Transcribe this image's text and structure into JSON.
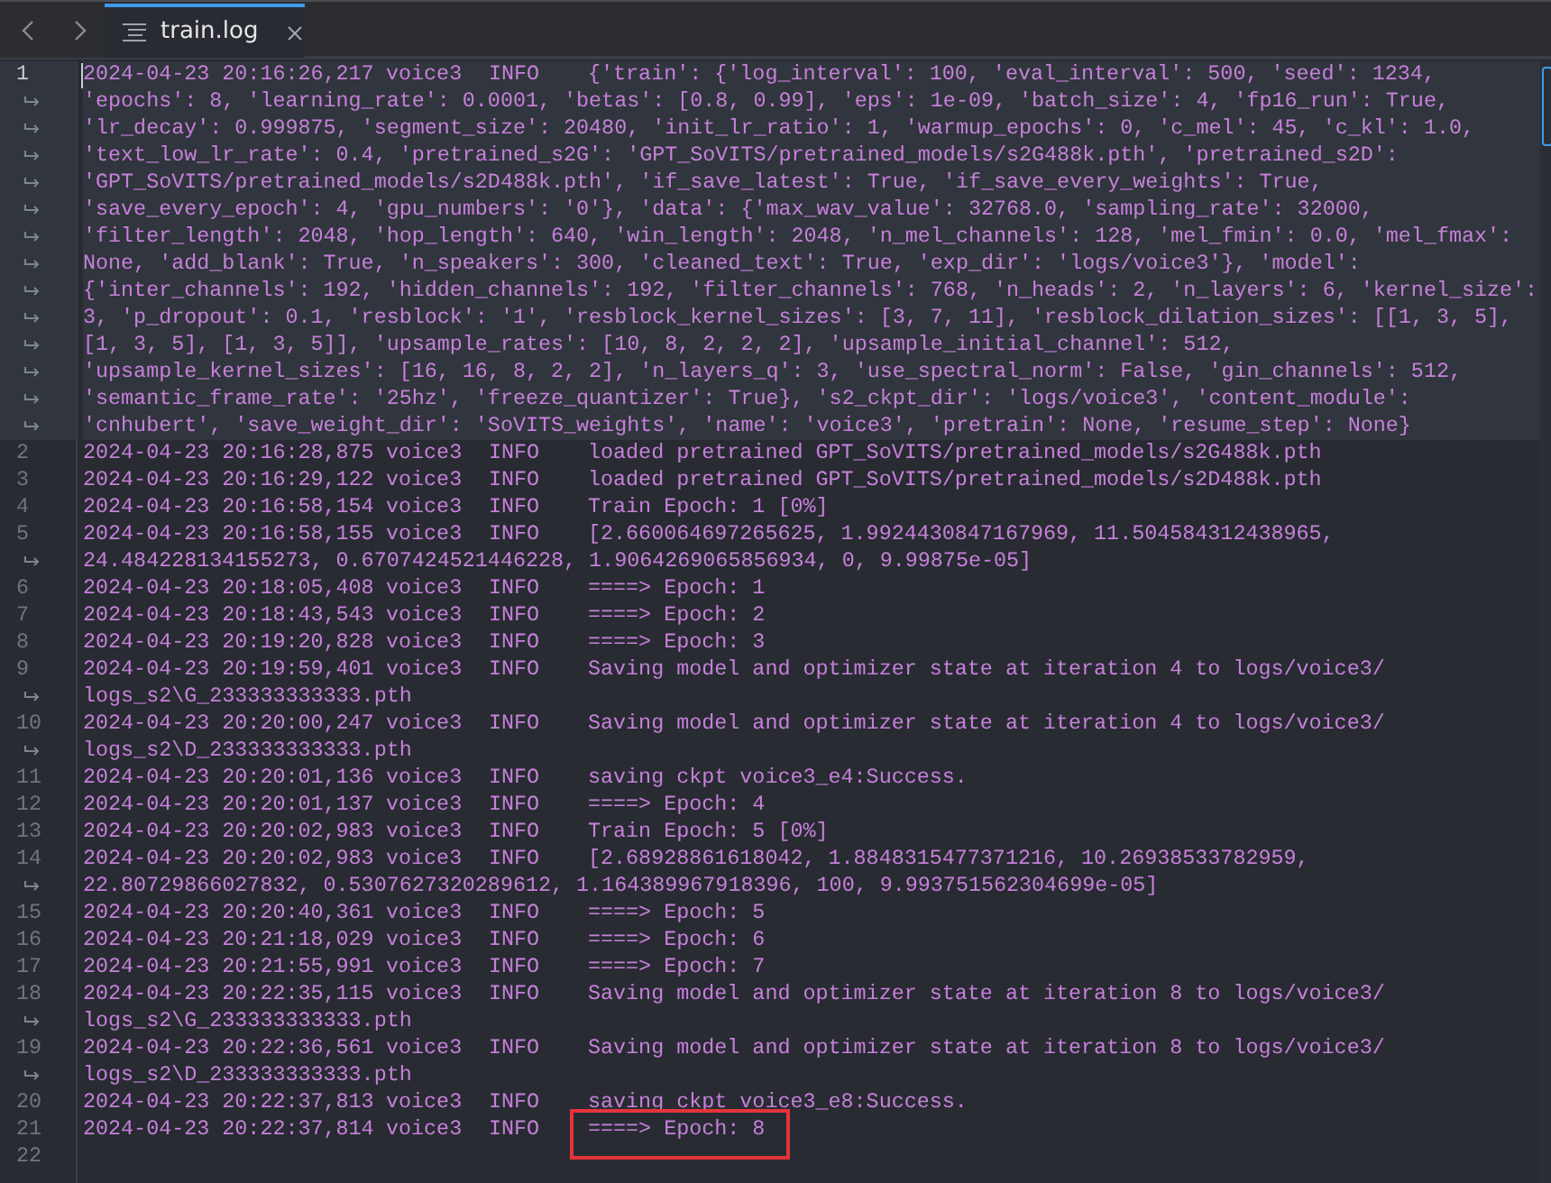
{
  "tabs": [
    {
      "label": "train.log",
      "selected": true
    }
  ],
  "lines": [
    {
      "number": "1",
      "current": true,
      "time": "2024-04-23 20:16:26,217",
      "logger": "voice3",
      "level": "INFO",
      "rows": [
        "{'train': {'log_interval': 100, 'eval_interval': 500, 'seed': 1234,",
        "'epochs': 8, 'learning_rate': 0.0001, 'betas': [0.8, 0.99], 'eps': 1e-09, 'batch_size': 4, 'fp16_run': True,",
        "'lr_decay': 0.999875, 'segment_size': 20480, 'init_lr_ratio': 1, 'warmup_epochs': 0, 'c_mel': 45, 'c_kl': 1.0,",
        "'text_low_lr_rate': 0.4, 'pretrained_s2G': 'GPT_SoVITS/pretrained_models/s2G488k.pth', 'pretrained_s2D':",
        "'GPT_SoVITS/pretrained_models/s2D488k.pth', 'if_save_latest': True, 'if_save_every_weights': True,",
        "'save_every_epoch': 4, 'gpu_numbers': '0'}, 'data': {'max_wav_value': 32768.0, 'sampling_rate': 32000,",
        "'filter_length': 2048, 'hop_length': 640, 'win_length': 2048, 'n_mel_channels': 128, 'mel_fmin': 0.0, 'mel_fmax':",
        "None, 'add_blank': True, 'n_speakers': 300, 'cleaned_text': True, 'exp_dir': 'logs/voice3'}, 'model':",
        "{'inter_channels': 192, 'hidden_channels': 192, 'filter_channels': 768, 'n_heads': 2, 'n_layers': 6, 'kernel_size':",
        "3, 'p_dropout': 0.1, 'resblock': '1', 'resblock_kernel_sizes': [3, 7, 11], 'resblock_dilation_sizes': [[1, 3, 5],",
        "[1, 3, 5], [1, 3, 5]], 'upsample_rates': [10, 8, 2, 2, 2], 'upsample_initial_channel': 512,",
        "'upsample_kernel_sizes': [16, 16, 8, 2, 2], 'n_layers_q': 3, 'use_spectral_norm': False, 'gin_channels': 512,",
        "'semantic_frame_rate': '25hz', 'freeze_quantizer': True}, 's2_ckpt_dir': 'logs/voice3', 'content_module':",
        "'cnhubert', 'save_weight_dir': 'SoVITS_weights', 'name': 'voice3', 'pretrain': None, 'resume_step': None}"
      ]
    },
    {
      "number": "2",
      "current": false,
      "time": "2024-04-23 20:16:28,875",
      "logger": "voice3",
      "level": "INFO",
      "rows": [
        "loaded pretrained GPT_SoVITS/pretrained_models/s2G488k.pth"
      ]
    },
    {
      "number": "3",
      "current": false,
      "time": "2024-04-23 20:16:29,122",
      "logger": "voice3",
      "level": "INFO",
      "rows": [
        "loaded pretrained GPT_SoVITS/pretrained_models/s2D488k.pth"
      ]
    },
    {
      "number": "4",
      "current": false,
      "time": "2024-04-23 20:16:58,154",
      "logger": "voice3",
      "level": "INFO",
      "rows": [
        "Train Epoch: 1 [0%]"
      ]
    },
    {
      "number": "5",
      "current": false,
      "time": "2024-04-23 20:16:58,155",
      "logger": "voice3",
      "level": "INFO",
      "rows": [
        "[2.660064697265625, 1.9924430847167969, 11.504584312438965,",
        "24.484228134155273, 0.6707424521446228, 1.9064269065856934, 0, 9.99875e-05]"
      ]
    },
    {
      "number": "6",
      "current": false,
      "time": "2024-04-23 20:18:05,408",
      "logger": "voice3",
      "level": "INFO",
      "rows": [
        "====> Epoch: 1"
      ]
    },
    {
      "number": "7",
      "current": false,
      "time": "2024-04-23 20:18:43,543",
      "logger": "voice3",
      "level": "INFO",
      "rows": [
        "====> Epoch: 2"
      ]
    },
    {
      "number": "8",
      "current": false,
      "time": "2024-04-23 20:19:20,828",
      "logger": "voice3",
      "level": "INFO",
      "rows": [
        "====> Epoch: 3"
      ]
    },
    {
      "number": "9",
      "current": false,
      "time": "2024-04-23 20:19:59,401",
      "logger": "voice3",
      "level": "INFO",
      "rows": [
        "Saving model and optimizer state at iteration 4 to logs/voice3/",
        "logs_s2\\G_233333333333.pth"
      ]
    },
    {
      "number": "10",
      "current": false,
      "time": "2024-04-23 20:20:00,247",
      "logger": "voice3",
      "level": "INFO",
      "rows": [
        "Saving model and optimizer state at iteration 4 to logs/voice3/",
        "logs_s2\\D_233333333333.pth"
      ]
    },
    {
      "number": "11",
      "current": false,
      "time": "2024-04-23 20:20:01,136",
      "logger": "voice3",
      "level": "INFO",
      "rows": [
        "saving ckpt voice3_e4:Success."
      ]
    },
    {
      "number": "12",
      "current": false,
      "time": "2024-04-23 20:20:01,137",
      "logger": "voice3",
      "level": "INFO",
      "rows": [
        "====> Epoch: 4"
      ]
    },
    {
      "number": "13",
      "current": false,
      "time": "2024-04-23 20:20:02,983",
      "logger": "voice3",
      "level": "INFO",
      "rows": [
        "Train Epoch: 5 [0%]"
      ]
    },
    {
      "number": "14",
      "current": false,
      "time": "2024-04-23 20:20:02,983",
      "logger": "voice3",
      "level": "INFO",
      "rows": [
        "[2.68928861618042, 1.8848315477371216, 10.26938533782959,",
        "22.80729866027832, 0.5307627320289612, 1.164389967918396, 100, 9.993751562304699e-05]"
      ]
    },
    {
      "number": "15",
      "current": false,
      "time": "2024-04-23 20:20:40,361",
      "logger": "voice3",
      "level": "INFO",
      "rows": [
        "====> Epoch: 5"
      ]
    },
    {
      "number": "16",
      "current": false,
      "time": "2024-04-23 20:21:18,029",
      "logger": "voice3",
      "level": "INFO",
      "rows": [
        "====> Epoch: 6"
      ]
    },
    {
      "number": "17",
      "current": false,
      "time": "2024-04-23 20:21:55,991",
      "logger": "voice3",
      "level": "INFO",
      "rows": [
        "====> Epoch: 7"
      ]
    },
    {
      "number": "18",
      "current": false,
      "time": "2024-04-23 20:22:35,115",
      "logger": "voice3",
      "level": "INFO",
      "rows": [
        "Saving model and optimizer state at iteration 8 to logs/voice3/",
        "logs_s2\\G_233333333333.pth"
      ]
    },
    {
      "number": "19",
      "current": false,
      "time": "2024-04-23 20:22:36,561",
      "logger": "voice3",
      "level": "INFO",
      "rows": [
        "Saving model and optimizer state at iteration 8 to logs/voice3/",
        "logs_s2\\D_233333333333.pth"
      ]
    },
    {
      "number": "20",
      "current": false,
      "time": "2024-04-23 20:22:37,813",
      "logger": "voice3",
      "level": "INFO",
      "rows": [
        "saving ckpt voice3_e8:Success."
      ]
    },
    {
      "number": "21",
      "current": false,
      "boxed": true,
      "time": "2024-04-23 20:22:37,814",
      "logger": "voice3",
      "level": "INFO",
      "rows": [
        "====> Epoch: 8"
      ]
    },
    {
      "number": "22",
      "current": false
    }
  ]
}
